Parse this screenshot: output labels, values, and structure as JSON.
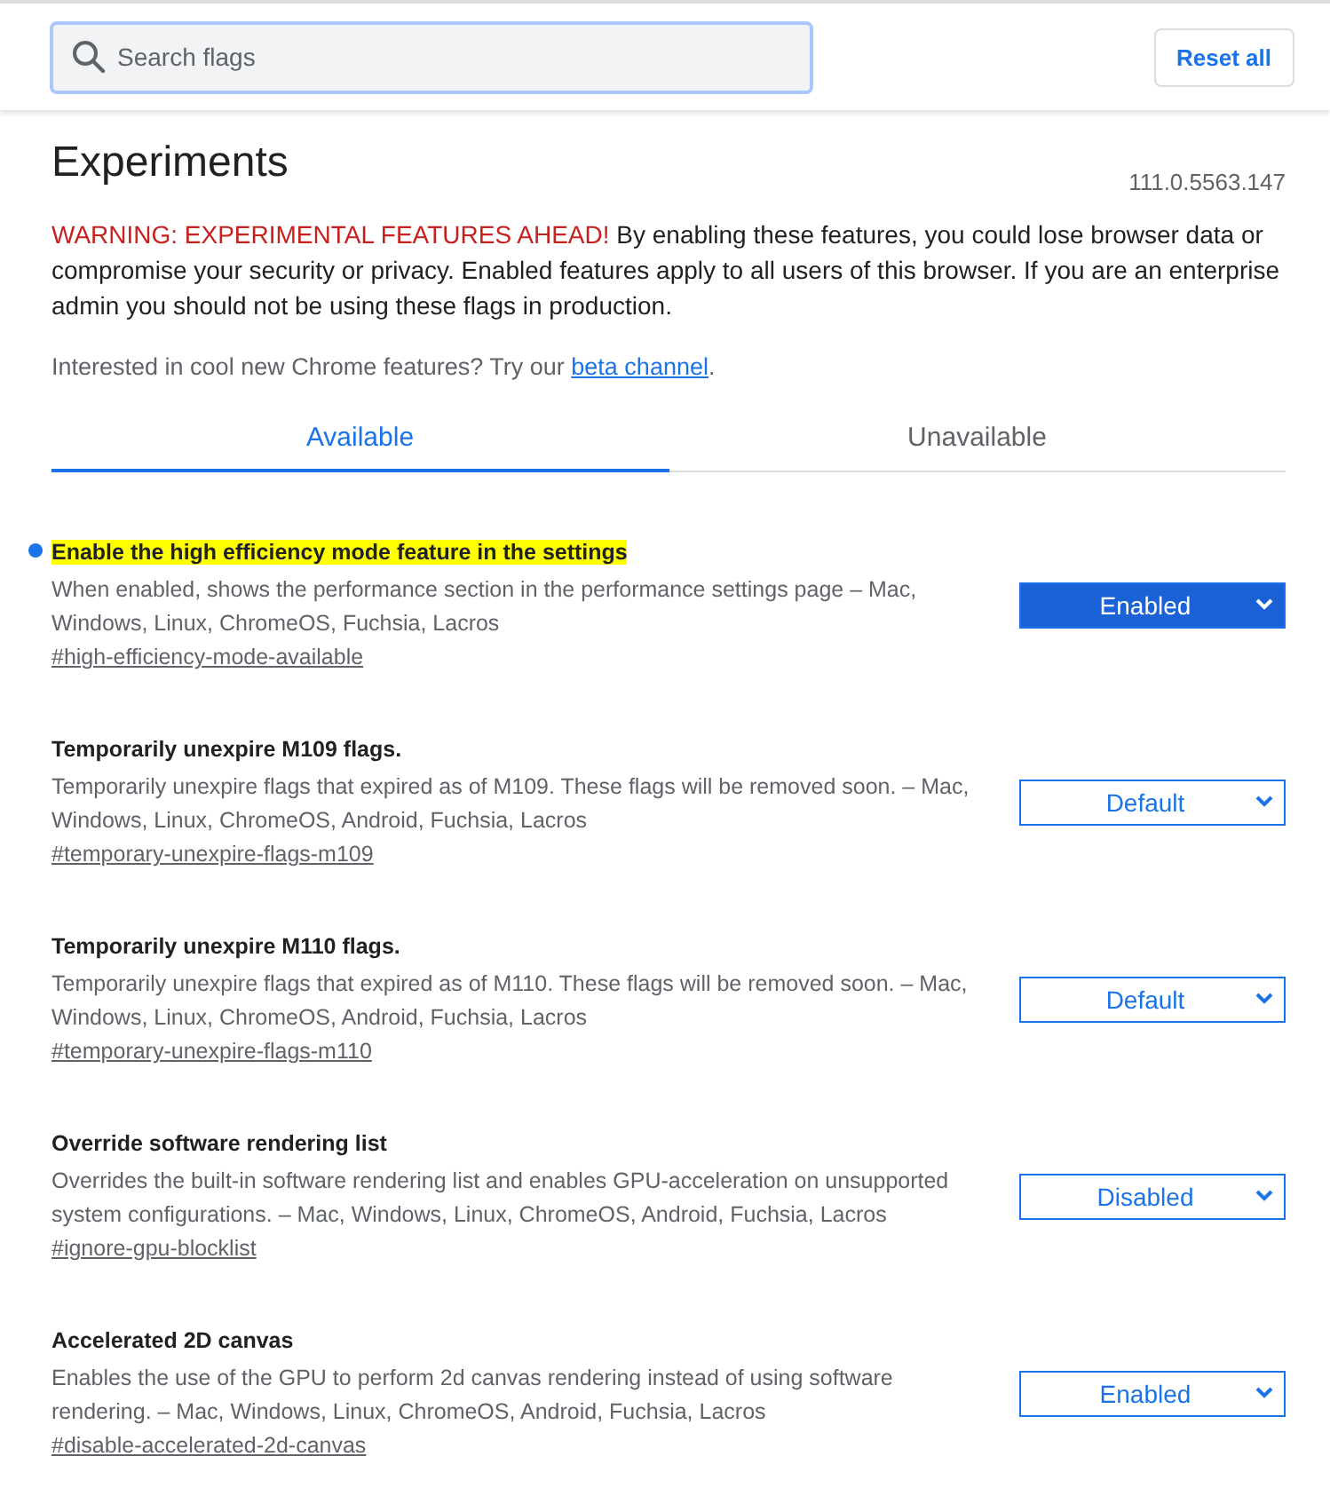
{
  "search": {
    "placeholder": "Search flags"
  },
  "reset_button": "Reset all",
  "title": "Experiments",
  "version": "111.0.5563.147",
  "warning": {
    "label": "WARNING: EXPERIMENTAL FEATURES AHEAD!",
    "text": "By enabling these features, you could lose browser data or compromise your security or privacy. Enabled features apply to all users of this browser. If you are an enterprise admin you should not be using these flags in production."
  },
  "promo": {
    "text": "Interested in cool new Chrome features? Try our",
    "link": "beta channel",
    "suffix": "."
  },
  "tabs": [
    {
      "label": "Available",
      "selected": true
    },
    {
      "label": "Unavailable",
      "selected": false
    }
  ],
  "flags": [
    {
      "title": "Enable the high efficiency mode feature in the settings",
      "highlighted": true,
      "modified": true,
      "description": "When enabled, shows the performance section in the performance settings page – Mac, Windows, Linux, ChromeOS, Fuchsia, Lacros",
      "link": "#high-efficiency-mode-available",
      "value": "Enabled"
    },
    {
      "title": "Temporarily unexpire M109 flags.",
      "highlighted": false,
      "modified": false,
      "description": "Temporarily unexpire flags that expired as of M109. These flags will be removed soon. – Mac, Windows, Linux, ChromeOS, Android, Fuchsia, Lacros",
      "link": "#temporary-unexpire-flags-m109",
      "value": "Default"
    },
    {
      "title": "Temporarily unexpire M110 flags.",
      "highlighted": false,
      "modified": false,
      "description": "Temporarily unexpire flags that expired as of M110. These flags will be removed soon. – Mac, Windows, Linux, ChromeOS, Android, Fuchsia, Lacros",
      "link": "#temporary-unexpire-flags-m110",
      "value": "Default"
    },
    {
      "title": "Override software rendering list",
      "highlighted": false,
      "modified": false,
      "description": "Overrides the built-in software rendering list and enables GPU-acceleration on unsupported system configurations. – Mac, Windows, Linux, ChromeOS, Android, Fuchsia, Lacros",
      "link": "#ignore-gpu-blocklist",
      "value": "Disabled"
    },
    {
      "title": "Accelerated 2D canvas",
      "highlighted": false,
      "modified": false,
      "description": "Enables the use of the GPU to perform 2d canvas rendering instead of using software rendering. – Mac, Windows, Linux, ChromeOS, Android, Fuchsia, Lacros",
      "link": "#disable-accelerated-2d-canvas",
      "value": "Enabled"
    }
  ]
}
